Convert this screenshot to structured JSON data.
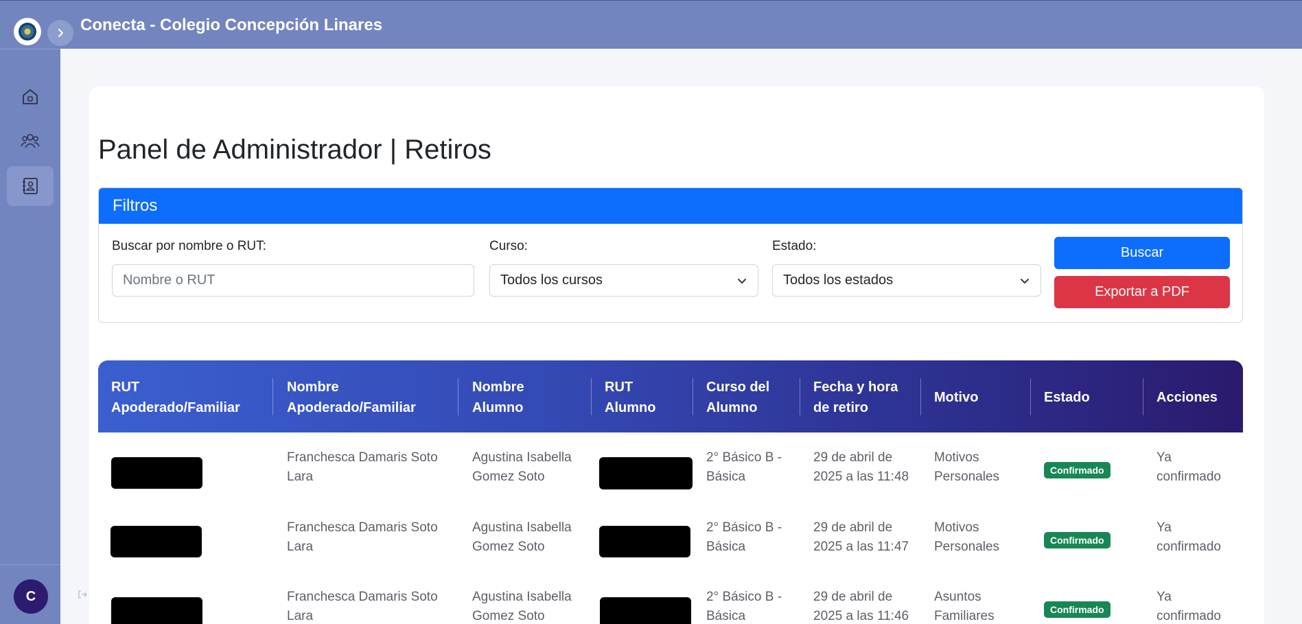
{
  "app": {
    "title": "Conecta - Colegio Concepción Linares"
  },
  "sidebar": {
    "items": [
      {
        "icon": "home-icon"
      },
      {
        "icon": "users-icon"
      },
      {
        "icon": "contact-book-icon"
      }
    ],
    "avatar_initial": "C"
  },
  "page": {
    "title": "Panel de Administrador | Retiros"
  },
  "filters": {
    "header": "Filtros",
    "search_label": "Buscar por nombre o RUT:",
    "search_placeholder": "Nombre o RUT",
    "course_label": "Curso:",
    "course_value": "Todos los cursos",
    "status_label": "Estado:",
    "status_value": "Todos los estados",
    "search_button": "Buscar",
    "export_button": "Exportar a PDF"
  },
  "table": {
    "headers": {
      "rut_apoderado": [
        "RUT",
        "Apoderado/Familiar"
      ],
      "nombre_apoderado": [
        "Nombre",
        "Apoderado/Familiar"
      ],
      "nombre_alumno": [
        "Nombre",
        "Alumno"
      ],
      "rut_alumno": [
        "RUT",
        "Alumno"
      ],
      "curso": [
        "Curso del",
        "Alumno"
      ],
      "fecha": [
        "Fecha y hora",
        "de retiro"
      ],
      "motivo": "Motivo",
      "estado": "Estado",
      "acciones": "Acciones"
    },
    "rows": [
      {
        "nombre_apoderado": [
          "Franchesca Damaris Soto",
          "Lara"
        ],
        "nombre_alumno": [
          "Agustina Isabella",
          "Gomez Soto"
        ],
        "curso": [
          "2° Básico B -",
          "Básica"
        ],
        "fecha": [
          "29 de abril de",
          "2025 a las 11:48"
        ],
        "motivo": [
          "Motivos",
          "Personales"
        ],
        "estado": "Confirmado",
        "acciones": [
          "Ya",
          "confirmado"
        ]
      },
      {
        "nombre_apoderado": [
          "Franchesca Damaris Soto",
          "Lara"
        ],
        "nombre_alumno": [
          "Agustina Isabella",
          "Gomez Soto"
        ],
        "curso": [
          "2° Básico B -",
          "Básica"
        ],
        "fecha": [
          "29 de abril de",
          "2025 a las 11:47"
        ],
        "motivo": [
          "Motivos",
          "Personales"
        ],
        "estado": "Confirmado",
        "acciones": [
          "Ya",
          "confirmado"
        ]
      },
      {
        "nombre_apoderado": [
          "Franchesca Damaris Soto",
          "Lara"
        ],
        "nombre_alumno": [
          "Agustina Isabella",
          "Gomez Soto"
        ],
        "curso": [
          "2° Básico B -",
          "Básica"
        ],
        "fecha": [
          "29 de abril de",
          "2025 a las 11:46"
        ],
        "motivo": [
          "Asuntos",
          "Familiares"
        ],
        "estado": "Confirmado",
        "acciones": [
          "Ya",
          "confirmado"
        ]
      }
    ]
  },
  "colors": {
    "header_bg": "#7385bf",
    "primary": "#0d6efd",
    "danger": "#dc3545",
    "success": "#198754",
    "table_gradient_start": "#3b5fcf",
    "table_gradient_end": "#2b1a6d"
  }
}
